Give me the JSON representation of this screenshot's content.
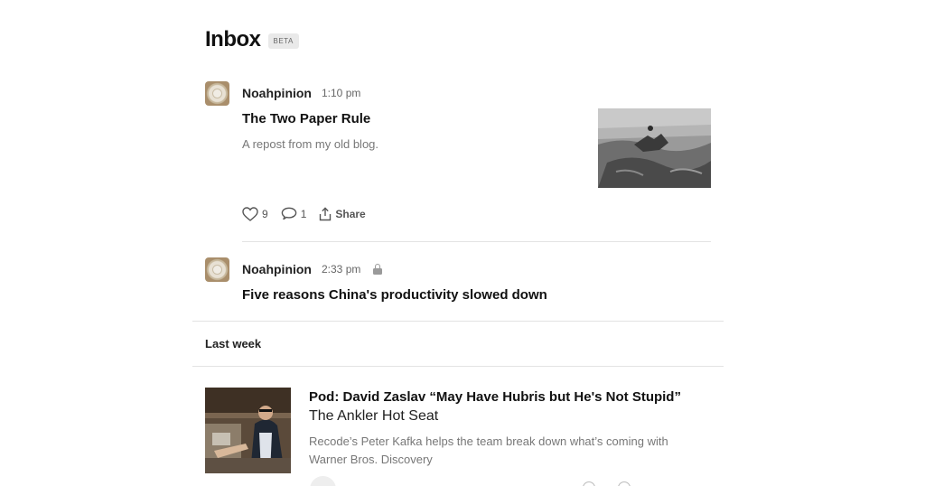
{
  "header": {
    "title": "Inbox",
    "badge": "BETA"
  },
  "posts": [
    {
      "author": "Noahpinion",
      "time": "1:10 pm",
      "title": "The Two Paper Rule",
      "subtitle": "A repost from my old blog.",
      "likes": "9",
      "comments": "1",
      "share_label": "Share"
    },
    {
      "author": "Noahpinion",
      "time": "2:33 pm",
      "title": "Five reasons China's productivity slowed down",
      "locked": true
    }
  ],
  "section_label": "Last week",
  "podcast": {
    "title": "Pod: David Zaslav “May Have Hubris but He's Not Stupid”",
    "show": "The Ankler Hot Seat",
    "description": "Recode’s Peter Kafka helps the team break down what’s coming with Warner Bros. Discovery"
  },
  "icons": {
    "like": "heart-icon",
    "comment": "comment-icon",
    "share": "share-icon",
    "lock": "lock-icon"
  }
}
